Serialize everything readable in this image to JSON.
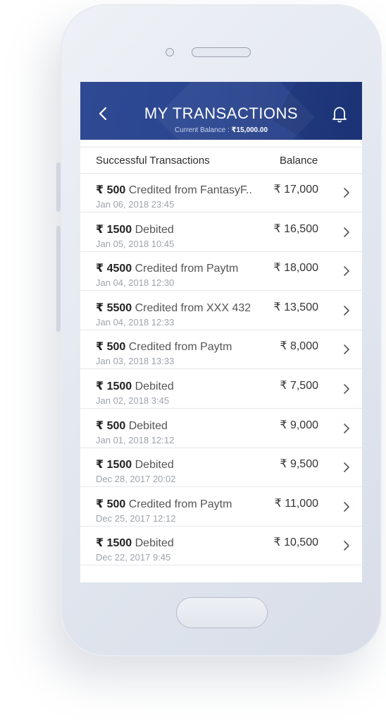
{
  "header": {
    "title": "MY TRANSACTIONS",
    "balance_label": "Current Balance : ",
    "balance_value": "₹15,000.00"
  },
  "columns": {
    "left": "Successful Transactions",
    "right": "Balance"
  },
  "currency": "₹",
  "transactions": [
    {
      "amount": "₹ 500",
      "desc": " Credited from FantasyF..",
      "date": "Jan 06, 2018 23:45",
      "balance": "₹ 17,000"
    },
    {
      "amount": "₹ 1500",
      "desc": " Debited",
      "date": "Jan 05, 2018 10:45",
      "balance": "₹ 16,500"
    },
    {
      "amount": "₹ 4500",
      "desc": " Credited from Paytm",
      "date": "Jan 04, 2018 12:30",
      "balance": "₹ 18,000"
    },
    {
      "amount": "₹ 5500",
      "desc": " Credited from XXX 432",
      "date": "Jan 04, 2018 12:33",
      "balance": "₹ 13,500"
    },
    {
      "amount": "₹ 500",
      "desc": " Credited from Paytm",
      "date": "Jan 03, 2018 13:33",
      "balance": "₹ 8,000"
    },
    {
      "amount": "₹ 1500",
      "desc": " Debited",
      "date": "Jan 02, 2018 3:45",
      "balance": "₹ 7,500"
    },
    {
      "amount": "₹ 500",
      "desc": " Debited",
      "date": "Jan 01, 2018 12:12",
      "balance": "₹ 9,000"
    },
    {
      "amount": "₹ 1500",
      "desc": " Debited",
      "date": "Dec 28, 2017 20:02",
      "balance": "₹ 9,500"
    },
    {
      "amount": "₹ 500",
      "desc": " Credited from Paytm",
      "date": "Dec 25, 2017 12:12",
      "balance": "₹ 11,000"
    },
    {
      "amount": "₹ 1500",
      "desc": " Debited",
      "date": "Dec 22, 2017 9:45",
      "balance": "₹ 10,500"
    }
  ],
  "icons": {
    "back": "chevron-left-icon",
    "notifications": "bell-icon",
    "row_action": "chevron-right-icon"
  },
  "colors": {
    "header": "#2a4590",
    "phone_body": "#e0e5ee"
  }
}
